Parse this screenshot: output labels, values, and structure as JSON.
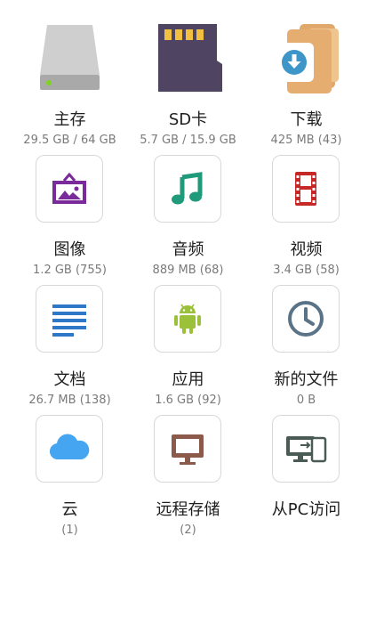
{
  "items": [
    {
      "label": "主存",
      "sub": "29.5 GB / 64 GB",
      "icon": "hard-drive-icon"
    },
    {
      "label": "SD卡",
      "sub": "5.7 GB / 15.9 GB",
      "icon": "sd-card-icon"
    },
    {
      "label": "下载",
      "sub": "425 MB (43)",
      "icon": "download-folder-icon"
    },
    {
      "label": "图像",
      "sub": "1.2 GB (755)",
      "icon": "image-icon"
    },
    {
      "label": "音频",
      "sub": "889 MB (68)",
      "icon": "music-note-icon"
    },
    {
      "label": "视频",
      "sub": "3.4 GB (58)",
      "icon": "film-icon"
    },
    {
      "label": "文档",
      "sub": "26.7 MB (138)",
      "icon": "document-lines-icon"
    },
    {
      "label": "应用",
      "sub": "1.6 GB (92)",
      "icon": "android-icon"
    },
    {
      "label": "新的文件",
      "sub": "0 B",
      "icon": "clock-icon"
    },
    {
      "label": "云",
      "sub": "(1)",
      "icon": "cloud-icon"
    },
    {
      "label": "远程存储",
      "sub": "(2)",
      "icon": "monitor-icon"
    },
    {
      "label": "从PC访问",
      "sub": "",
      "icon": "pc-transfer-icon"
    }
  ],
  "colors": {
    "image": "#7b2a9c",
    "music": "#1f9a7a",
    "film": "#c62828",
    "document": "#2e77c9",
    "android": "#9bc13a",
    "clock": "#5a7387",
    "cloud": "#46a5f0",
    "monitor": "#8c5a4a",
    "pc": "#4a5a55"
  }
}
